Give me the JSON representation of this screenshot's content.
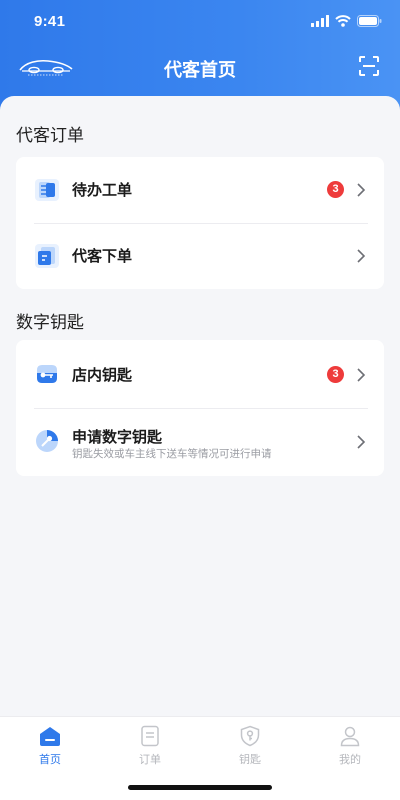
{
  "status_bar": {
    "time": "9:41"
  },
  "nav": {
    "title": "代客首页"
  },
  "sections": {
    "orders": {
      "title": "代客订单",
      "items": [
        {
          "label": "待办工单",
          "badge": "3"
        },
        {
          "label": "代客下单"
        }
      ]
    },
    "keys": {
      "title": "数字钥匙",
      "items": [
        {
          "label": "店内钥匙",
          "badge": "3"
        },
        {
          "label": "申请数字钥匙",
          "subtitle": "钥匙失效或车主线下送车等情况可进行申请"
        }
      ]
    }
  },
  "tabbar": {
    "tabs": [
      {
        "label": "首页",
        "active": true
      },
      {
        "label": "订单"
      },
      {
        "label": "钥匙"
      },
      {
        "label": "我的"
      }
    ]
  },
  "colors": {
    "primary": "#2f79ea",
    "badge": "#ee3b3b"
  }
}
